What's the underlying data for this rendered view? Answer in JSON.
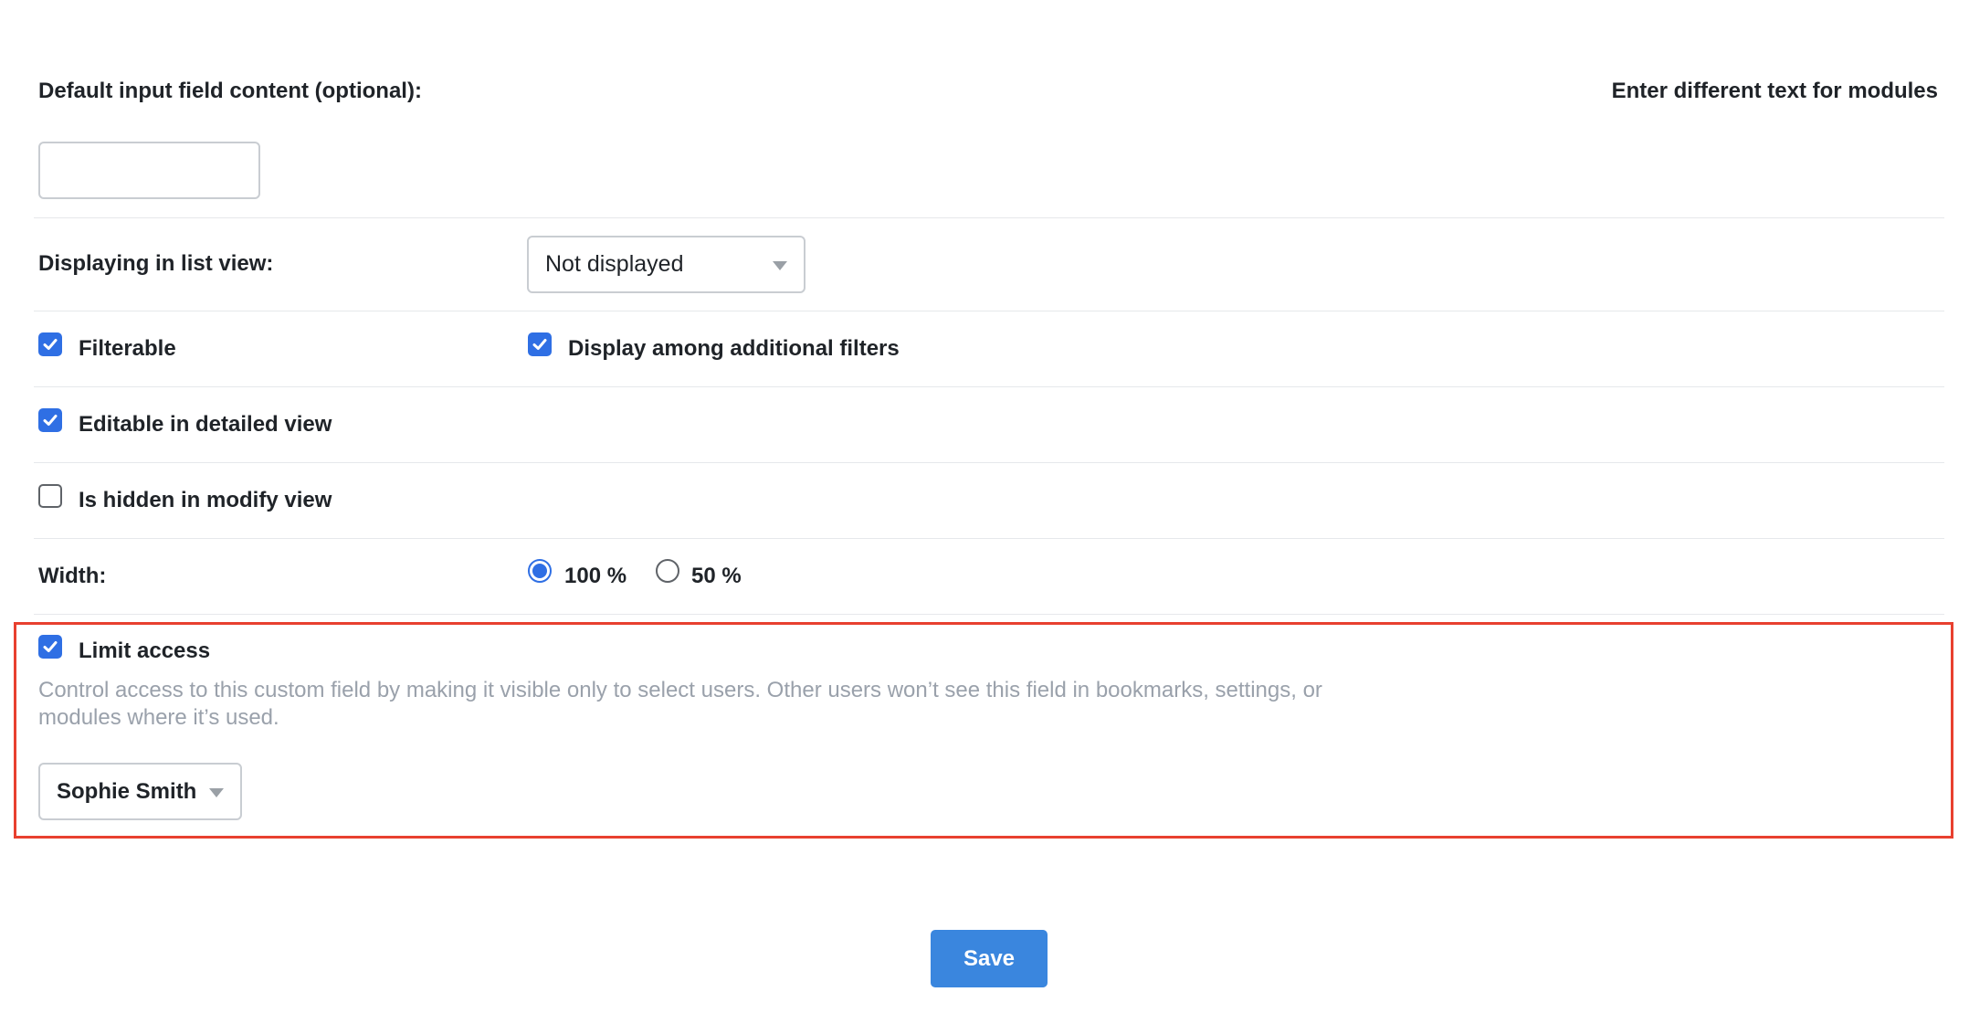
{
  "default_content": {
    "label": "Default input field content (optional):",
    "value": "",
    "modules_link": "Enter different text for modules"
  },
  "list_view": {
    "label": "Displaying in list view:",
    "selected": "Not displayed"
  },
  "options": {
    "filterable": {
      "label": "Filterable",
      "checked": true
    },
    "additional_filters": {
      "label": "Display among additional filters",
      "checked": true
    },
    "editable_detailed": {
      "label": "Editable in detailed view",
      "checked": true
    },
    "hidden_modify": {
      "label": "Is hidden in modify view",
      "checked": false
    }
  },
  "width": {
    "label": "Width:",
    "options": [
      {
        "label": "100 %",
        "selected": true
      },
      {
        "label": "50 %",
        "selected": false
      }
    ]
  },
  "limit_access": {
    "label": "Limit access",
    "checked": true,
    "help": "Control access to this custom field by making it visible only to select users. Other users won’t see this field in bookmarks, settings, or modules where it’s used.",
    "user_selected": "Sophie Smith"
  },
  "actions": {
    "save_label": "Save"
  },
  "colors": {
    "accent": "#2f6fe4",
    "save_button": "#3a86de",
    "highlight_border": "#e8402f",
    "help_text": "#9aa1ab"
  }
}
